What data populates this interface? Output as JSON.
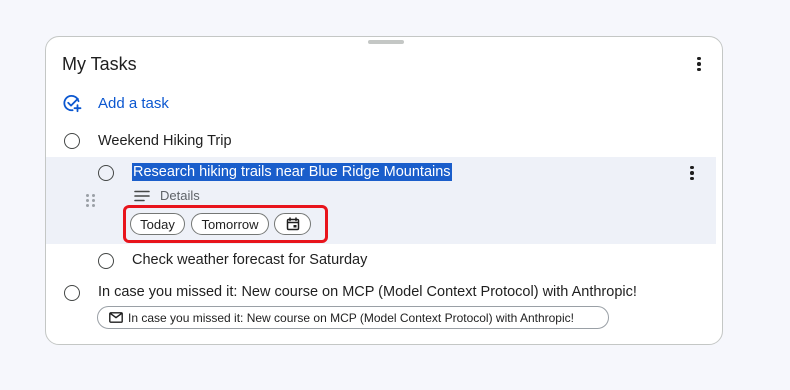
{
  "panel": {
    "title": "My Tasks"
  },
  "add_task": {
    "label": "Add a task"
  },
  "tasks": [
    {
      "title": "Weekend Hiking Trip"
    },
    {
      "title": "Research hiking trails near Blue Ridge Mountains",
      "selected": true
    },
    {
      "title": "Check weather forecast for Saturday"
    },
    {
      "title": "In case you missed it: New course on MCP (Model Context Protocol) with Anthropic!"
    }
  ],
  "selected_task": {
    "details_label": "Details",
    "date_chips": {
      "today": "Today",
      "tomorrow": "Tomorrow",
      "calendar_icon": "calendar-icon"
    }
  },
  "email_chip": {
    "label": "In case you missed it: New course on MCP (Model Context Protocol) with Anthropic!",
    "icon": "mail-icon"
  },
  "colors": {
    "accent": "#0b57d0",
    "highlight": "#1a5ecb",
    "annotation": "#e8141c",
    "selected_row": "#eef1f8"
  }
}
